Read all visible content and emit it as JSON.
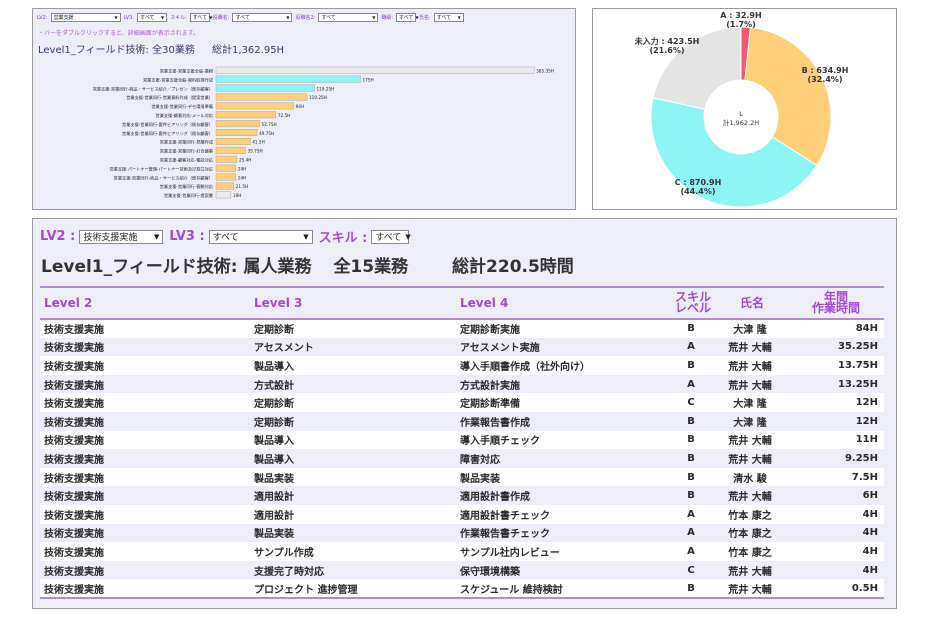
{
  "top_panel": {
    "filters": [
      {
        "label": "LV2:",
        "value": "営業支援"
      },
      {
        "label": "LV3:",
        "value": "すべて"
      },
      {
        "label": "スキル:",
        "value": "すべて"
      },
      {
        "label": "役職名:",
        "value": "すべて"
      },
      {
        "label": "役職名2:",
        "value": "すべて"
      },
      {
        "label": "職級:",
        "value": "すべて"
      },
      {
        "label": "氏名:",
        "value": "すべて"
      }
    ],
    "hint": "・バーをダブルクリックすると、詳細画面が表示されます。",
    "title": "Level1_フィールド技術: 全30業務",
    "total": "総計1,362.95H"
  },
  "chart_data": [
    {
      "type": "bar",
      "orientation": "horizontal",
      "categories": [
        "営業支援-営業支援全般-業務",
        "営業支援-営業支援全般-資料取得作成",
        "営業支援-営業同行-商品・サービス紹介／プレゼン（既存顧客）",
        "営業支援-営業同行-営業資料作成（提案営業）",
        "営業支援-営業同行-デモ環境準備",
        "営業支援-顧客対応-メール対応",
        "営業支援-営業同行-要件ヒアリング（既存顧客）",
        "営業支援-営業同行-要件ヒアリング（既存顧客）",
        "営業支援-営業同行-見積作成",
        "営業支援-営業同行-打合議事",
        "営業支援-顧客対応-電話対応",
        "営業支援-パートナー管理-パートナー技術及び窓口対応",
        "営業支援-営業同行-商品・サービス紹介（既存顧客）",
        "営業支援-営業同行-客観対応",
        "営業支援-営業同行-提案書"
      ],
      "values": [
        385.35,
        175,
        119.25,
        110.25,
        94,
        72.5,
        52.75,
        49.75,
        41.5,
        35.75,
        25.4,
        24,
        24,
        21.5,
        18
      ],
      "value_labels": [
        "385.35H",
        "175H",
        "119.25H",
        "110.25H",
        "94H",
        "72.5H",
        "52.75H",
        "49.75H",
        "41.5H",
        "35.75H",
        "25.4H",
        "24H",
        "24H",
        "21.5H",
        "18H"
      ],
      "colors": [
        "#eaeaea",
        "#8ef5f5",
        "#8ef5f5",
        "#ffcf7a",
        "#ffcf7a",
        "#ffcf7a",
        "#ffcf7a",
        "#ffcf7a",
        "#ffcf7a",
        "#ffcf7a",
        "#ffcf7a",
        "#ffcf7a",
        "#ffcf7a",
        "#ffcf7a",
        "#eaeaea"
      ],
      "xlim": [
        0,
        390
      ]
    },
    {
      "type": "pie",
      "donut": true,
      "center_label_line1": "L",
      "center_label_line2": "計1,962.2H",
      "slices": [
        {
          "name": "A",
          "value": 32.9,
          "percent": "(1.7%)",
          "label": "A : 32.9H",
          "color": "#f05a6e"
        },
        {
          "name": "B",
          "value": 634.9,
          "percent": "(32.4%)",
          "label": "B : 634.9H",
          "color": "#ffcf7a"
        },
        {
          "name": "C",
          "value": 870.9,
          "percent": "(44.4%)",
          "label": "C : 870.9H",
          "color": "#8ef5f5"
        },
        {
          "name": "未入力",
          "value": 423.5,
          "percent": "(21.6%)",
          "label": "未入力 : 423.5H",
          "color": "#e4e4e4"
        }
      ]
    }
  ],
  "table_panel": {
    "filters": {
      "lv2_label": "LV2 :",
      "lv2_value": "技術支援実施",
      "lv3_label": "LV3 :",
      "lv3_value": "すべて",
      "skill_label": "スキル :",
      "skill_value": "すべて"
    },
    "title": "Level1_フィールド技術: 属人業務",
    "count": "全15業務",
    "total": "総計220.5時間",
    "columns": {
      "level2": "Level 2",
      "level3": "Level 3",
      "level4": "Level 4",
      "skill_line1": "スキル",
      "skill_line2": "レベル",
      "name": "氏名",
      "hours_line1": "年間",
      "hours_line2": "作業時間"
    },
    "rows": [
      {
        "level2": "技術支援実施",
        "level3": "定期診断",
        "level4": "定期診断実施",
        "skill": "B",
        "name": "大津 隆",
        "hours": "84H"
      },
      {
        "level2": "技術支援実施",
        "level3": "アセスメント",
        "level4": "アセスメント実施",
        "skill": "A",
        "name": "荒井 大輔",
        "hours": "35.25H"
      },
      {
        "level2": "技術支援実施",
        "level3": "製品導入",
        "level4": "導入手順書作成（社外向け）",
        "skill": "B",
        "name": "荒井 大輔",
        "hours": "13.75H"
      },
      {
        "level2": "技術支援実施",
        "level3": "方式設計",
        "level4": "方式設計実施",
        "skill": "A",
        "name": "荒井 大輔",
        "hours": "13.25H"
      },
      {
        "level2": "技術支援実施",
        "level3": "定期診断",
        "level4": "定期診断準備",
        "skill": "C",
        "name": "大津 隆",
        "hours": "12H"
      },
      {
        "level2": "技術支援実施",
        "level3": "定期診断",
        "level4": "作業報告書作成",
        "skill": "B",
        "name": "大津 隆",
        "hours": "12H"
      },
      {
        "level2": "技術支援実施",
        "level3": "製品導入",
        "level4": "導入手順チェック",
        "skill": "B",
        "name": "荒井 大輔",
        "hours": "11H"
      },
      {
        "level2": "技術支援実施",
        "level3": "製品導入",
        "level4": "障害対応",
        "skill": "B",
        "name": "荒井 大輔",
        "hours": "9.25H"
      },
      {
        "level2": "技術支援実施",
        "level3": "製品実装",
        "level4": "製品実装",
        "skill": "B",
        "name": "清水 駿",
        "hours": "7.5H"
      },
      {
        "level2": "技術支援実施",
        "level3": "適用設計",
        "level4": "適用設計書作成",
        "skill": "B",
        "name": "荒井 大輔",
        "hours": "6H"
      },
      {
        "level2": "技術支援実施",
        "level3": "適用設計",
        "level4": "適用設計書チェック",
        "skill": "A",
        "name": "竹本 康之",
        "hours": "4H"
      },
      {
        "level2": "技術支援実施",
        "level3": "製品実装",
        "level4": "作業報告書チェック",
        "skill": "A",
        "name": "竹本 康之",
        "hours": "4H"
      },
      {
        "level2": "技術支援実施",
        "level3": "サンプル作成",
        "level4": "サンプル社内レビュー",
        "skill": "A",
        "name": "竹本 康之",
        "hours": "4H"
      },
      {
        "level2": "技術支援実施",
        "level3": "支援完了時対応",
        "level4": "保守環境構築",
        "skill": "C",
        "name": "荒井 大輔",
        "hours": "4H"
      },
      {
        "level2": "技術支援実施",
        "level3": "プロジェクト 進捗管理",
        "level4": "スケジュール 維持検討",
        "skill": "B",
        "name": "荒井 大輔",
        "hours": "0.5H"
      }
    ]
  }
}
